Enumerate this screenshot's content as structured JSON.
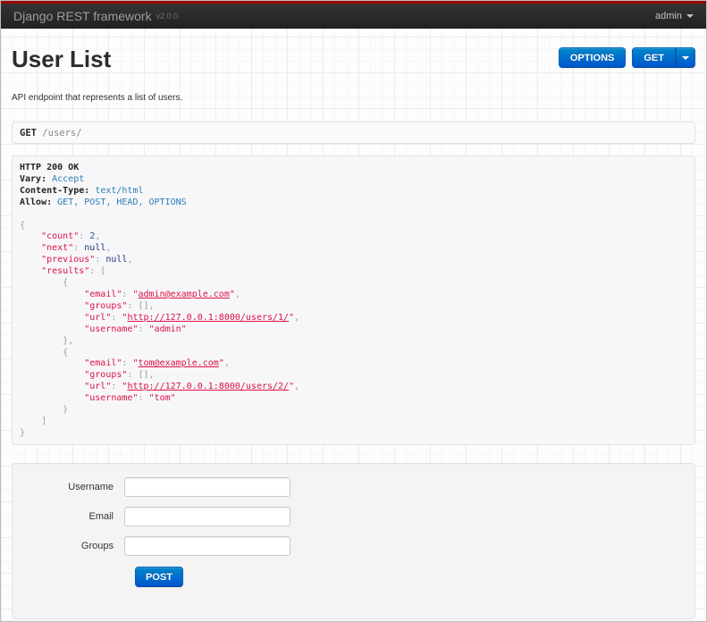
{
  "navbar": {
    "brand": "Django REST framework",
    "version": "v2.0.0",
    "user": "admin"
  },
  "page": {
    "title": "User List",
    "description": "API endpoint that represents a list of users."
  },
  "toolbar": {
    "options_label": "OPTIONS",
    "get_label": "GET"
  },
  "request": {
    "method": "GET",
    "path": "/users/"
  },
  "response": {
    "status_line": "HTTP 200 OK",
    "headers": {
      "Vary": "Accept",
      "Content-Type": "text/html",
      "Allow": "GET, POST, HEAD, OPTIONS"
    },
    "body_json": {
      "count": 2,
      "next": null,
      "previous": null,
      "results": [
        {
          "email": "admin@example.com",
          "groups": [],
          "url": "http://127.0.0.1:8000/users/1/",
          "username": "admin"
        },
        {
          "email": "tom@example.com",
          "groups": [],
          "url": "http://127.0.0.1:8000/users/2/",
          "username": "tom"
        }
      ]
    },
    "lines": [
      [
        [
          "hdr",
          "HTTP 200 OK"
        ]
      ],
      [
        [
          "hdr",
          "Vary:"
        ],
        [
          "pln",
          " "
        ],
        [
          "blue",
          "Accept"
        ]
      ],
      [
        [
          "hdr",
          "Content-Type:"
        ],
        [
          "pln",
          " "
        ],
        [
          "blue",
          "text/html"
        ]
      ],
      [
        [
          "hdr",
          "Allow:"
        ],
        [
          "pln",
          " "
        ],
        [
          "blue",
          "GET, POST, HEAD, OPTIONS"
        ]
      ],
      [],
      [
        [
          "pun",
          "{"
        ]
      ],
      [
        [
          "pln",
          "    "
        ],
        [
          "str",
          "\"count\""
        ],
        [
          "pun",
          ":"
        ],
        [
          "pln",
          " "
        ],
        [
          "num",
          "2"
        ],
        [
          "pun",
          ","
        ]
      ],
      [
        [
          "pln",
          "    "
        ],
        [
          "str",
          "\"next\""
        ],
        [
          "pun",
          ":"
        ],
        [
          "pln",
          " "
        ],
        [
          "kwd",
          "null"
        ],
        [
          "pun",
          ","
        ]
      ],
      [
        [
          "pln",
          "    "
        ],
        [
          "str",
          "\"previous\""
        ],
        [
          "pun",
          ":"
        ],
        [
          "pln",
          " "
        ],
        [
          "kwd",
          "null"
        ],
        [
          "pun",
          ","
        ]
      ],
      [
        [
          "pln",
          "    "
        ],
        [
          "str",
          "\"results\""
        ],
        [
          "pun",
          ":"
        ],
        [
          "pln",
          " "
        ],
        [
          "pun",
          "["
        ]
      ],
      [
        [
          "pln",
          "        "
        ],
        [
          "pun",
          "{"
        ]
      ],
      [
        [
          "pln",
          "            "
        ],
        [
          "str",
          "\"email\""
        ],
        [
          "pun",
          ":"
        ],
        [
          "pln",
          " "
        ],
        [
          "str",
          "\""
        ],
        [
          "link",
          "admin@example.com"
        ],
        [
          "str",
          "\""
        ],
        [
          "pun",
          ","
        ]
      ],
      [
        [
          "pln",
          "            "
        ],
        [
          "str",
          "\"groups\""
        ],
        [
          "pun",
          ":"
        ],
        [
          "pln",
          " "
        ],
        [
          "pun",
          "[],"
        ]
      ],
      [
        [
          "pln",
          "            "
        ],
        [
          "str",
          "\"url\""
        ],
        [
          "pun",
          ":"
        ],
        [
          "pln",
          " "
        ],
        [
          "str",
          "\""
        ],
        [
          "link",
          "http://127.0.0.1:8000/users/1/"
        ],
        [
          "str",
          "\""
        ],
        [
          "pun",
          ","
        ]
      ],
      [
        [
          "pln",
          "            "
        ],
        [
          "str",
          "\"username\""
        ],
        [
          "pun",
          ":"
        ],
        [
          "pln",
          " "
        ],
        [
          "str",
          "\"admin\""
        ]
      ],
      [
        [
          "pln",
          "        "
        ],
        [
          "pun",
          "},"
        ]
      ],
      [
        [
          "pln",
          "        "
        ],
        [
          "pun",
          "{"
        ]
      ],
      [
        [
          "pln",
          "            "
        ],
        [
          "str",
          "\"email\""
        ],
        [
          "pun",
          ":"
        ],
        [
          "pln",
          " "
        ],
        [
          "str",
          "\""
        ],
        [
          "link",
          "tom@example.com"
        ],
        [
          "str",
          "\""
        ],
        [
          "pun",
          ","
        ]
      ],
      [
        [
          "pln",
          "            "
        ],
        [
          "str",
          "\"groups\""
        ],
        [
          "pun",
          ":"
        ],
        [
          "pln",
          " "
        ],
        [
          "pun",
          "[],"
        ]
      ],
      [
        [
          "pln",
          "            "
        ],
        [
          "str",
          "\"url\""
        ],
        [
          "pun",
          ":"
        ],
        [
          "pln",
          " "
        ],
        [
          "str",
          "\""
        ],
        [
          "link",
          "http://127.0.0.1:8000/users/2/"
        ],
        [
          "str",
          "\""
        ],
        [
          "pun",
          ","
        ]
      ],
      [
        [
          "pln",
          "            "
        ],
        [
          "str",
          "\"username\""
        ],
        [
          "pun",
          ":"
        ],
        [
          "pln",
          " "
        ],
        [
          "str",
          "\"tom\""
        ]
      ],
      [
        [
          "pln",
          "        "
        ],
        [
          "pun",
          "}"
        ]
      ],
      [
        [
          "pln",
          "    "
        ],
        [
          "pun",
          "]"
        ]
      ],
      [
        [
          "pun",
          "}"
        ]
      ]
    ]
  },
  "form": {
    "fields": [
      {
        "label": "Username",
        "value": "",
        "placeholder": ""
      },
      {
        "label": "Email",
        "value": "",
        "placeholder": ""
      },
      {
        "label": "Groups",
        "value": "",
        "placeholder": ""
      }
    ],
    "submit_label": "POST"
  },
  "colors": {
    "top_bar_red": "#9b0000",
    "navbar_dark": "#2b2b2b",
    "accent_blue": "#0074cc",
    "string_red": "#dd1144",
    "header_value_blue": "#2d7eb4",
    "number_blue": "#195f91",
    "keyword_navy": "#1e347b",
    "punctuation_gray": "#93a1a1"
  }
}
